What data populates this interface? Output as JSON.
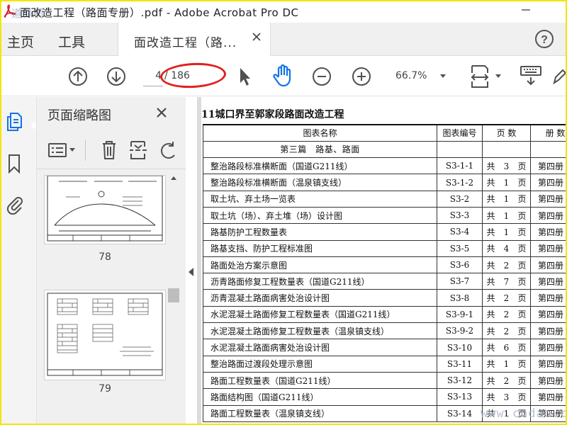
{
  "window": {
    "title": "面改造工程（路面专册）.pdf - Adobe Acrobat Pro DC",
    "minimize_glyph": "—",
    "watermark_top": "道縣網"
  },
  "tabs": {
    "home": "主页",
    "tools": "工具",
    "document": "面改造工程（路...",
    "help_glyph": "?"
  },
  "toolbar": {
    "current_page": "4",
    "total_pages": "/ 186",
    "zoom": "66.7%",
    "icons": [
      "page-up-icon",
      "page-down-icon",
      "select-cursor-icon",
      "hand-tool-icon",
      "zoom-out-icon",
      "zoom-in-icon",
      "page-fit-icon",
      "keyboard-icon",
      "pen-icon"
    ]
  },
  "thumbnails_panel": {
    "title": "页面缩略图",
    "thumbs": [
      {
        "label": "78"
      },
      {
        "label": "79"
      }
    ]
  },
  "document": {
    "heading": "11城口界至郭家段路面改造工程",
    "table": {
      "headers": [
        "图表名称",
        "图表编号",
        "页 数",
        "册 数"
      ],
      "section": "第三篇　路基、路面",
      "rows": [
        {
          "name": "整治路段标准横断面（国道G211线）",
          "code": "S3-1-1",
          "gong": "共",
          "count": "3",
          "ye": "页",
          "book": "第四册"
        },
        {
          "name": "整治路段标准横断面（温泉镇支线）",
          "code": "S3-1-2",
          "gong": "共",
          "count": "1",
          "ye": "页",
          "book": "第四册"
        },
        {
          "name": "取土坑、弃土场一览表",
          "code": "S3-2",
          "gong": "共",
          "count": "1",
          "ye": "页",
          "book": "第四册"
        },
        {
          "name": "取土坑（场）、弃土堆（场）设计图",
          "code": "S3-3",
          "gong": "共",
          "count": "1",
          "ye": "页",
          "book": "第四册"
        },
        {
          "name": "路基防护工程数量表",
          "code": "S3-4",
          "gong": "共",
          "count": "1",
          "ye": "页",
          "book": "第四册"
        },
        {
          "name": "路基支挡、防护工程标准图",
          "code": "S3-5",
          "gong": "共",
          "count": "4",
          "ye": "页",
          "book": "第四册"
        },
        {
          "name": "路面处治方案示意图",
          "code": "S3-6",
          "gong": "共",
          "count": "2",
          "ye": "页",
          "book": "第四册"
        },
        {
          "name": "沥青路面修复工程数量表（国道G211线）",
          "code": "S3-7",
          "gong": "共",
          "count": "7",
          "ye": "页",
          "book": "第四册"
        },
        {
          "name": "沥青混凝土路面病害处治设计图",
          "code": "S3-8",
          "gong": "共",
          "count": "2",
          "ye": "页",
          "book": "第四册"
        },
        {
          "name": "水泥混凝土路面修复工程数量表（国道G211线）",
          "code": "S3-9-1",
          "gong": "共",
          "count": "2",
          "ye": "页",
          "book": "第四册"
        },
        {
          "name": "水泥混凝土路面修复工程数量表（温泉镇支线）",
          "code": "S3-9-2",
          "gong": "共",
          "count": "2",
          "ye": "页",
          "book": "第四册"
        },
        {
          "name": "水泥混凝土路面病害处治设计图",
          "code": "S3-10",
          "gong": "共",
          "count": "6",
          "ye": "页",
          "book": "第四册"
        },
        {
          "name": "整治路面过渡段处理示意图",
          "code": "S3-11",
          "gong": "共",
          "count": "1",
          "ye": "页",
          "book": "第四册"
        },
        {
          "name": "路面工程数量表（国道G211线）",
          "code": "S3-12",
          "gong": "共",
          "count": "2",
          "ye": "页",
          "book": "第四册"
        },
        {
          "name": "路面结构图（国道G211线）",
          "code": "S3-13",
          "gong": "共",
          "count": "3",
          "ye": "页",
          "book": "第四册"
        },
        {
          "name": "路面工程数量表（温泉镇支线）",
          "code": "S3-14",
          "gong": "共",
          "count": "1",
          "ye": "页",
          "book": "第四册"
        }
      ]
    }
  },
  "watermark": "www.cndao.com",
  "colors": {
    "accent_blue": "#1473e6",
    "icon_gray": "#505050",
    "highlight_oval": "#e02020",
    "frame_yellow": "#f2e600"
  }
}
